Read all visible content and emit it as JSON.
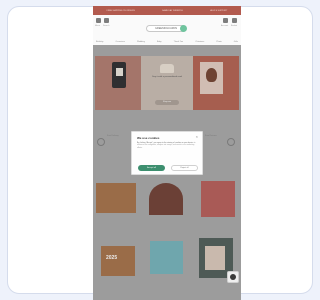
{
  "topbar": {
    "left": "FREE SHIPPING ON ORDERS",
    "center": "SAME DAY DISPATCH",
    "right": "HELP & SUPPORT"
  },
  "header": {
    "logo": "GREENINGCARDS",
    "left_labels": [
      "Menu",
      "Search"
    ],
    "right_labels": [
      "Account",
      "Basket"
    ]
  },
  "nav": {
    "items": [
      "Birthday",
      "Occasions",
      "Wedding",
      "Baby",
      "Thank You",
      "Christmas",
      "Photo",
      "Gifts"
    ]
  },
  "hero": {
    "title": "Say it with a personalised card",
    "button": "Shop now"
  },
  "sections": {
    "left_label": "Fast Delivery",
    "right_label": "Free Returns"
  },
  "cookie_modal": {
    "title": "We use cookies",
    "close": "×",
    "body_lead": "By clicking “Accept”, you agree to the storing of cookies on your device",
    "body_rest": "to enhance site navigation, analyse site usage, and assist in our marketing efforts.",
    "accept": "Accept all",
    "reject": "Reject all"
  },
  "tiles": {
    "year_text": "2025"
  },
  "colors": {
    "topbar": "#b25a4e",
    "accent": "#3d8f6f",
    "overlay": "#9c9c9c"
  },
  "icons": [
    "menu-icon",
    "search-icon",
    "account-icon",
    "basket-icon",
    "close-icon",
    "chat-icon"
  ]
}
